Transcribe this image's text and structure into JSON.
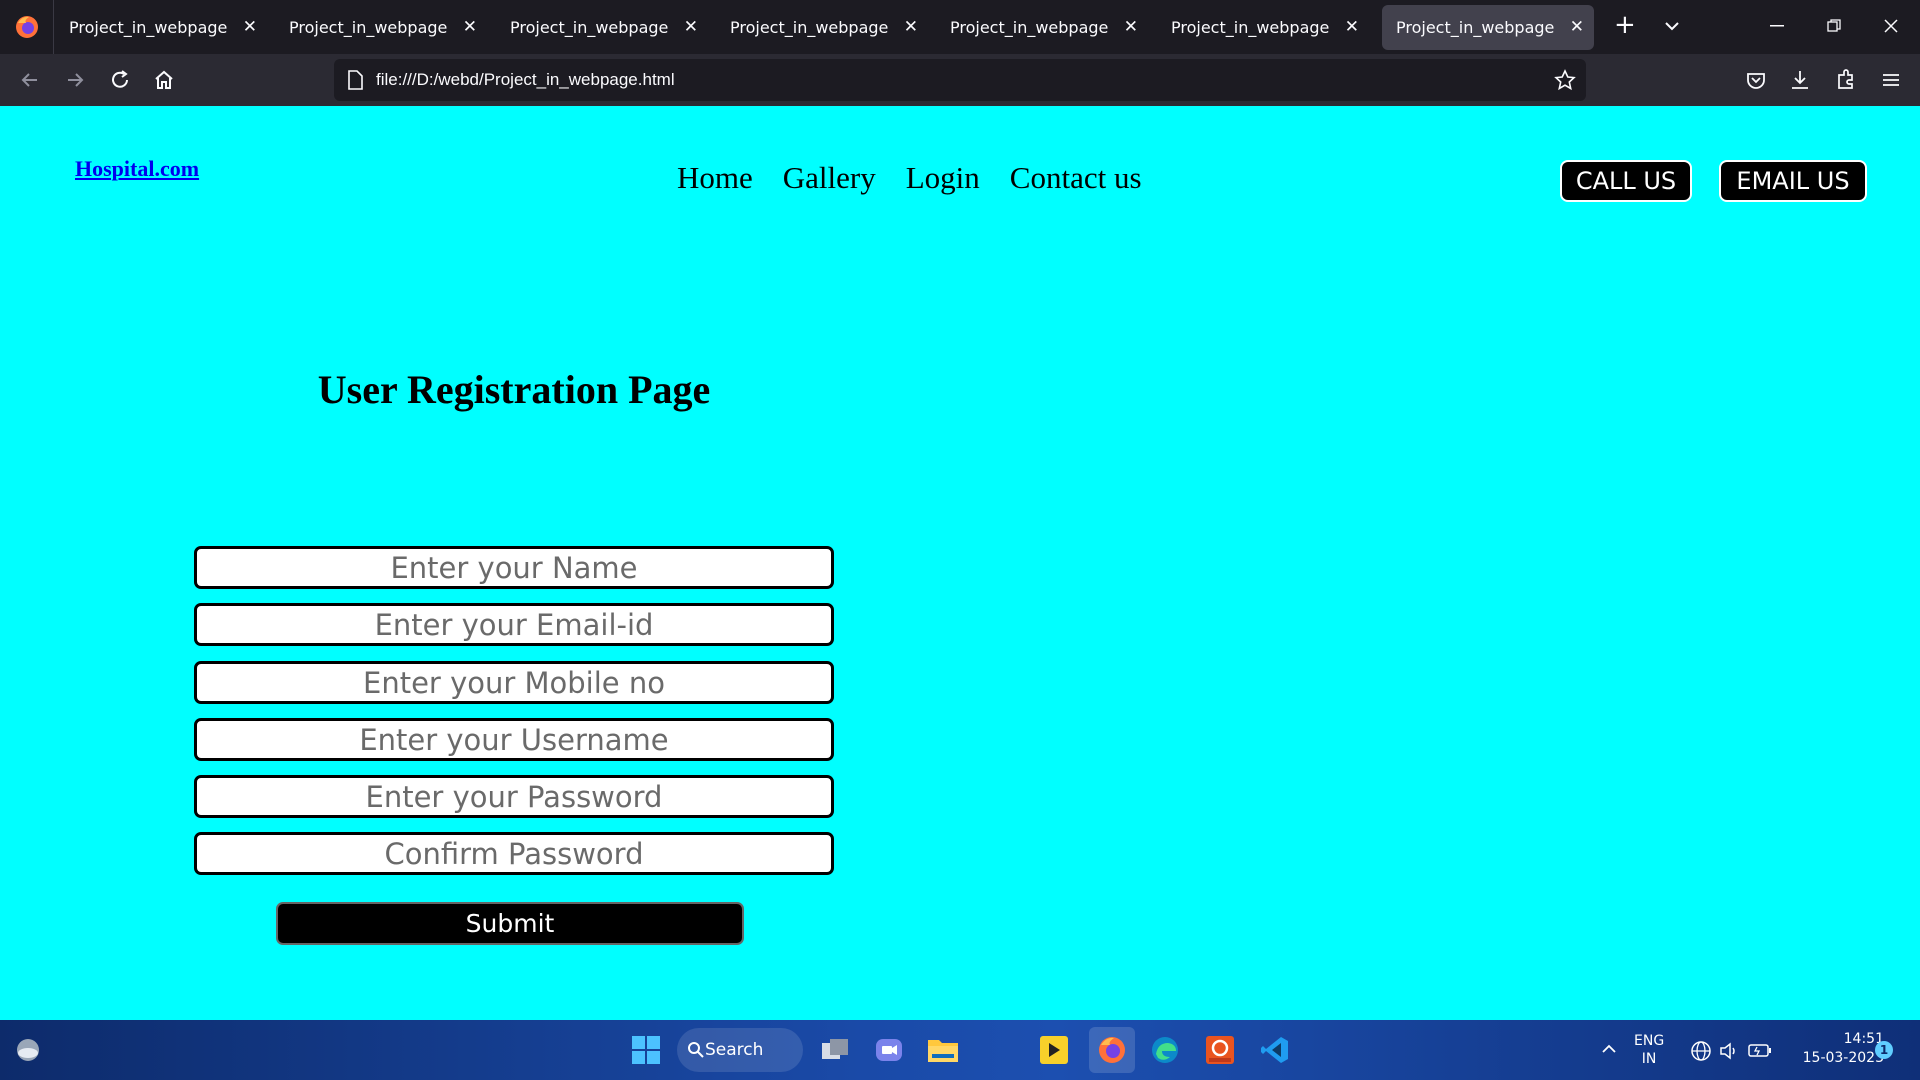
{
  "browser": {
    "tabs": [
      {
        "title": "Project_in_webpage",
        "active": false
      },
      {
        "title": "Project_in_webpage",
        "active": false
      },
      {
        "title": "Project_in_webpage",
        "active": false
      },
      {
        "title": "Project_in_webpage",
        "active": false
      },
      {
        "title": "Project_in_webpage",
        "active": false
      },
      {
        "title": "Project_in_webpage",
        "active": false
      },
      {
        "title": "Project_in_webpage",
        "active": true
      }
    ],
    "url": "file:///D:/webd/Project_in_webpage.html"
  },
  "site": {
    "logo": "Hospital.com",
    "menu": [
      "Home",
      "Gallery",
      "Login",
      "Contact us"
    ],
    "call_btn": "CALL US",
    "email_btn": "EMAIL US"
  },
  "form": {
    "title": "User Registration Page",
    "fields": [
      "Enter your Name",
      "Enter your Email-id",
      "Enter your Mobile no",
      "Enter your Username",
      "Enter your Password",
      "Confirm Password"
    ],
    "submit": "Submit"
  },
  "taskbar": {
    "search_label": "Search",
    "lang_1": "ENG",
    "lang_2": "IN",
    "time": "14:51",
    "date": "15-03-2023",
    "notification_count": "1"
  }
}
